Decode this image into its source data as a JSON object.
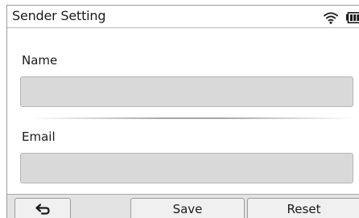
{
  "header": {
    "title": "Sender Setting",
    "wifi_icon": "wifi-icon",
    "battery_icon": "battery-icon"
  },
  "form": {
    "name_label": "Name",
    "name_value": "",
    "email_label": "Email",
    "email_value": ""
  },
  "toolbar": {
    "back_icon": "return-arrow-icon",
    "save_label": "Save",
    "reset_label": "Reset"
  }
}
